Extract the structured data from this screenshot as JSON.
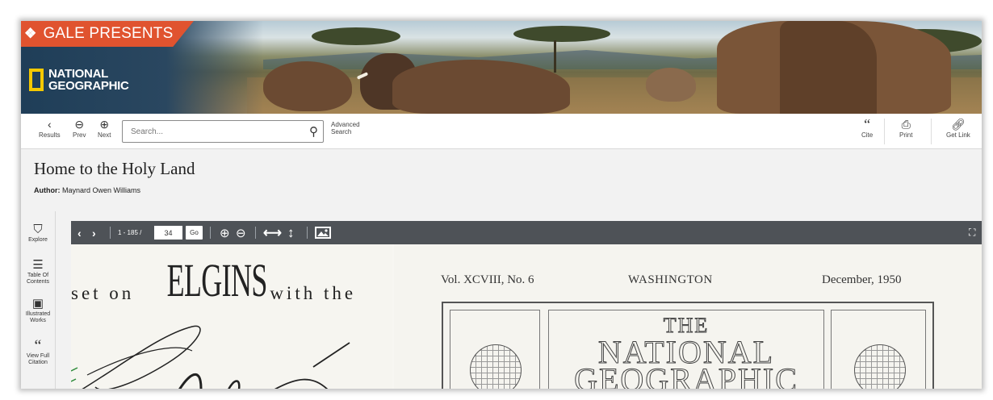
{
  "banner": {
    "brand": "GALE PRESENTS",
    "logo_lines": [
      "NATIONAL",
      "GEOGRAPHIC"
    ],
    "colors": {
      "gale_red": "#e0532f",
      "natgeo_yellow": "#f5c900"
    }
  },
  "toolbar": {
    "results_label": "Results",
    "prev_label": "Prev",
    "next_label": "Next",
    "search_placeholder": "Search...",
    "advanced_search_lines": [
      "Advanced",
      "Search"
    ],
    "cite_label": "Cite",
    "print_label": "Print",
    "get_link_label": "Get Link",
    "icons": {
      "results": "chevron-left-icon",
      "prev": "circle-arrow-left-icon",
      "next": "circle-arrow-right-icon",
      "search": "search-icon",
      "cite": "quote-icon",
      "print": "printer-icon",
      "get_link": "link-icon"
    }
  },
  "document": {
    "title": "Home to the Holy Land",
    "author_label": "Author:",
    "author": "Maynard Owen Williams"
  },
  "rail": {
    "items": [
      {
        "label": "Explore",
        "icon": "binoculars-icon"
      },
      {
        "label_lines": [
          "Table Of",
          "Contents"
        ],
        "icon": "list-icon"
      },
      {
        "label_lines": [
          "Illustrated",
          "Works"
        ],
        "icon": "image-icon"
      },
      {
        "label_lines": [
          "View Full",
          "Citation"
        ],
        "icon": "quote-icon"
      }
    ]
  },
  "viewer": {
    "page_range": "1 - 185 /",
    "page_value": "34",
    "go_label": "Go",
    "icons": [
      "chevron-left-icon",
      "chevron-right-icon",
      "zoom-in-icon",
      "zoom-out-icon",
      "fit-width-icon",
      "fit-height-icon",
      "image-icon",
      "fullscreen-icon"
    ]
  },
  "scan": {
    "left_page": {
      "pre": "set on",
      "brand": "ELGINS",
      "post": "with the"
    },
    "right_page": {
      "volume": "Vol. XCVIII, No. 6",
      "city": "WASHINGTON",
      "date": "December, 1950",
      "title_lines": [
        "THE",
        "NATIONAL",
        "GEOGRAPHIC"
      ]
    }
  }
}
